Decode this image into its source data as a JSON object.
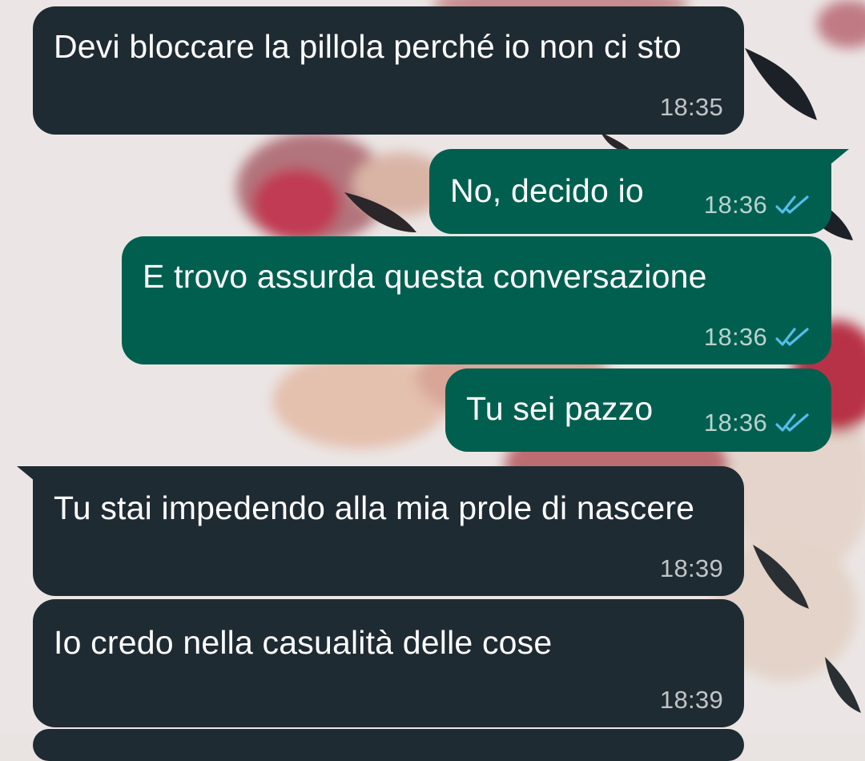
{
  "chat": {
    "messages": [
      {
        "direction": "in",
        "text": "Devi bloccare la pillola perché io non ci sto",
        "time": "18:35",
        "status": ""
      },
      {
        "direction": "out",
        "text": "No, decido io",
        "time": "18:36",
        "status": "read"
      },
      {
        "direction": "out",
        "text": "E trovo assurda questa conversazione",
        "time": "18:36",
        "status": "read"
      },
      {
        "direction": "out",
        "text": "Tu sei pazzo",
        "time": "18:36",
        "status": "read"
      },
      {
        "direction": "in",
        "text": "Tu stai impedendo alla mia prole di nascere",
        "time": "18:39",
        "status": ""
      },
      {
        "direction": "in",
        "text": "Io credo nella casualità delle cose",
        "time": "18:39",
        "status": ""
      }
    ]
  },
  "colors": {
    "incoming_bubble": "#1f2b33",
    "outgoing_bubble": "#005f4f",
    "read_ticks": "#53bdeb",
    "time_text": "#b9c0c4"
  },
  "icons": {
    "read_receipt": "double-check-icon"
  }
}
